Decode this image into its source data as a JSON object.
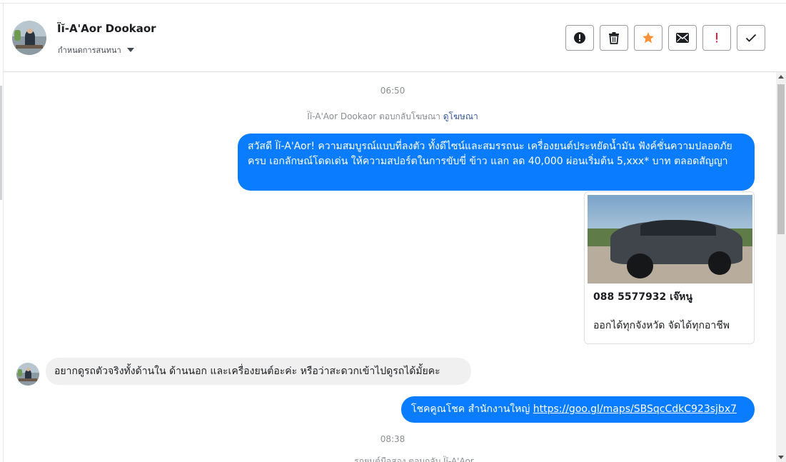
{
  "header": {
    "contact_name": "Ïĭ-A'Aor Dookaor",
    "subtitle": "กำหนดการสนทนา",
    "actions": [
      {
        "icon": "alert-circle-icon",
        "name": "mark-spam-button"
      },
      {
        "icon": "trash-icon",
        "name": "delete-button"
      },
      {
        "icon": "star-icon",
        "name": "star-button"
      },
      {
        "icon": "envelope-icon",
        "name": "mark-unread-button"
      },
      {
        "icon": "exclamation-icon",
        "name": "flag-button"
      },
      {
        "icon": "checkmark-icon",
        "name": "done-button"
      }
    ]
  },
  "conversation": {
    "time_1": "06:50",
    "system_1": {
      "text": "Ïĭ-A'Aor Dookaor ตอบกลับโฆษณา",
      "link": "ดูโฆษณา"
    },
    "message_1": "สวัสดี Ïĭ-A'Aor! ความสมบูรณ์แบบที่ลงตัว ทั้งดีไซน์และสมรรถนะ เครื่องยนต์ประหยัดน้ำมัน ฟังค์ชั่นความปลอดภัยครบ เอกลักษณ์โดดเด่น ให้ความสปอร์ตในการขับขี่ ข้าว แลก ลด 40,000 ผ่อนเริ่มต้น 5,xxx* บาท ตลอดสัญญา",
    "card": {
      "title": "088 5577932 เจ๊หนู",
      "description": "ออกได้ทุกจังหวัด จัดได้ทุกอาชีพ"
    },
    "message_2": "อยากดูรถตัวจริงทั้งด้านใน ด้านนอก และเครื่องยนต์อะค่ะ หรือว่าสะดวกเข้าไปดูรถได้มั้ยคะ",
    "message_3": {
      "text": "โชคคูณโชค สำนักงานใหญ่ ",
      "url": "https://goo.gl/maps/SBSqcCdkC923sjbx7"
    },
    "time_2": "08:38",
    "system_2": "รถยนต์มือสอง ตอบกลับ Ïĭ-A'Aor"
  },
  "colors": {
    "outgoing_bubble": "#0a7cff",
    "incoming_bubble": "#f0f0f0",
    "star": "#f7923a",
    "flag": "#e41e3f"
  }
}
